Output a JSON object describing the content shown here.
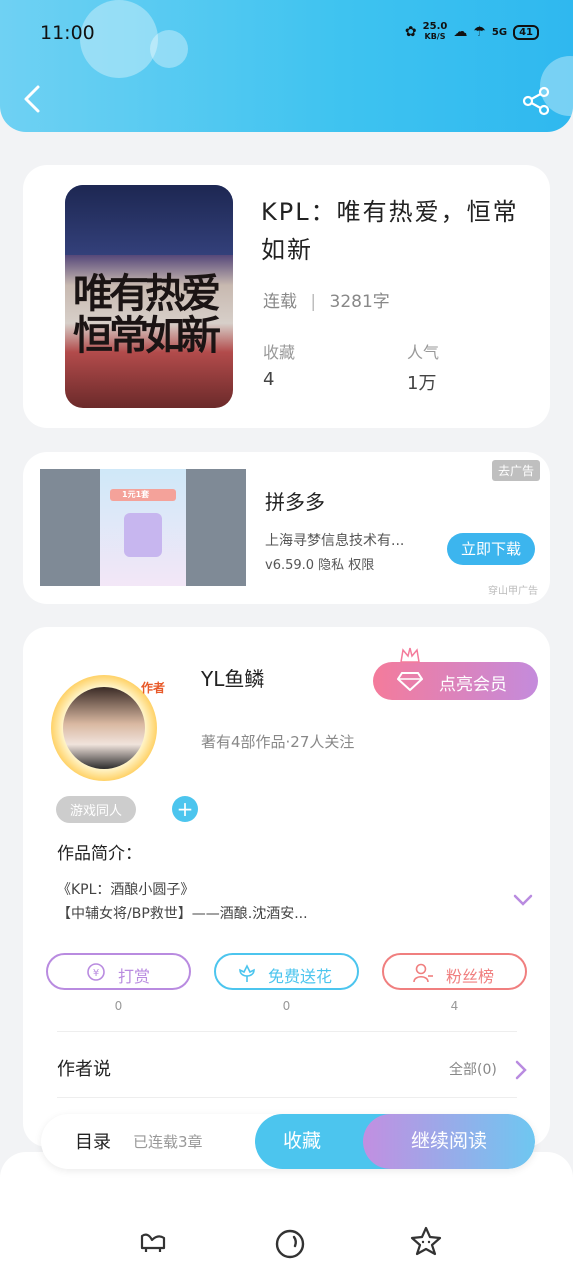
{
  "status_bar": {
    "time": "11:00",
    "net_speed": "25.0",
    "net_unit": "KB/S",
    "signal_label": "5G",
    "battery": "41"
  },
  "book": {
    "title": "KPL：唯有热爱，恒常如新",
    "status": "连载",
    "separator": "|",
    "word_count": "3281字",
    "cover_text": "唯有热爱 恒常如新",
    "collect_label": "收藏",
    "collect_value": "4",
    "popularity_label": "人气",
    "popularity_value": "1万"
  },
  "ad": {
    "tag": "去广告",
    "name": "拼多多",
    "company": "上海寻梦信息技术有...",
    "meta": "v6.59.0 隐私 权限",
    "button": "立即下载",
    "source": "穿山甲广告",
    "banner_text": "1元1套"
  },
  "author": {
    "name": "YL鱼鳞",
    "badge": "作者",
    "works": "著有4部作品·27人关注",
    "vip_button": "点亮会员",
    "tag": "游戏同人",
    "add_tag": "+",
    "intro_label": "作品简介：",
    "intro_line1": "《KPL：酒酿小圆子》",
    "intro_line2": "【中辅女将/BP救世】——酒酿.沈酒安..."
  },
  "actions": [
    {
      "label": "打赏",
      "count": "0",
      "color": "#b98be0"
    },
    {
      "label": "免费送花",
      "count": "0",
      "color": "#4cc5ee"
    },
    {
      "label": "粉丝榜",
      "count": "4",
      "color": "#f07f7f"
    }
  ],
  "author_says": {
    "title": "作者说",
    "all_link": "全部(0)"
  },
  "read_bar": {
    "toc": "目录",
    "chapters": "已连载3章",
    "collect": "收藏",
    "continue": "继续阅读"
  },
  "colors": {
    "accent": "#4cc5ee",
    "vip_gradient_start": "#f47b9b",
    "vip_gradient_end": "#c48bdc"
  },
  "icons": [
    "back-icon",
    "share-icon",
    "crown-icon",
    "diamond-icon",
    "yuan-icon",
    "flower-icon",
    "fans-icon",
    "chevron-down-icon",
    "chevron-right-icon",
    "sofa-icon",
    "planet-icon",
    "star-face-icon"
  ]
}
